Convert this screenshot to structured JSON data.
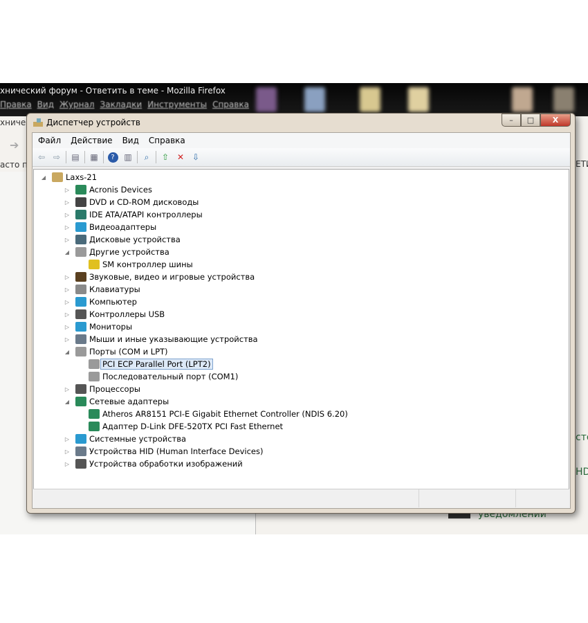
{
  "background": {
    "firefox_title": "хнический форум - Ответить в теме - Mozilla Firefox",
    "firefox_menu": [
      "Правка",
      "Вид",
      "Журнал",
      "Закладки",
      "Инструменты",
      "Справка"
    ],
    "side_texts": [
      "хнический",
      "асто по"
    ],
    "right_texts": [
      "ЕТИ",
      "сто",
      "HD"
    ],
    "notification_text": "уведомлений"
  },
  "window": {
    "title": "Диспетчер устройств",
    "controls": {
      "minimize": "–",
      "maximize": "□",
      "close": "X"
    },
    "menu": [
      "Файл",
      "Действие",
      "Вид",
      "Справка"
    ],
    "toolbar": [
      "back",
      "forward",
      "show-hide-tree",
      "properties",
      "help",
      "action-pane",
      "scan-hardware",
      "update-driver",
      "disable-device",
      "uninstall-device"
    ]
  },
  "tree": {
    "root": "Laxs-21",
    "items": [
      {
        "label": "Acronis Devices",
        "level": 1,
        "expanded": false,
        "icon": "monitor-network",
        "color": "#2a8a5a"
      },
      {
        "label": "DVD и CD-ROM дисководы",
        "level": 1,
        "expanded": false,
        "icon": "dvd-drive",
        "color": "#444444"
      },
      {
        "label": "IDE ATA/ATAPI контроллеры",
        "level": 1,
        "expanded": false,
        "icon": "ide-controller",
        "color": "#2a7a6a"
      },
      {
        "label": "Видеоадаптеры",
        "level": 1,
        "expanded": false,
        "icon": "video-adapter",
        "color": "#2a9ad0"
      },
      {
        "label": "Дисковые устройства",
        "level": 1,
        "expanded": false,
        "icon": "disk-drive",
        "color": "#4a6a7a"
      },
      {
        "label": "Другие устройства",
        "level": 1,
        "expanded": true,
        "icon": "unknown-device",
        "color": "#9a9a9a"
      },
      {
        "label": "SM контроллер шины",
        "level": 2,
        "icon": "warning-device",
        "color": "#e0c020"
      },
      {
        "label": "Звуковые, видео и игровые устройства",
        "level": 1,
        "expanded": false,
        "icon": "speaker",
        "color": "#5a4020"
      },
      {
        "label": "Клавиатуры",
        "level": 1,
        "expanded": false,
        "icon": "keyboard",
        "color": "#8a8a8a"
      },
      {
        "label": "Компьютер",
        "level": 1,
        "expanded": false,
        "icon": "computer",
        "color": "#2a9ad0"
      },
      {
        "label": "Контроллеры USB",
        "level": 1,
        "expanded": false,
        "icon": "usb",
        "color": "#555555"
      },
      {
        "label": "Мониторы",
        "level": 1,
        "expanded": false,
        "icon": "monitor",
        "color": "#2a9ad0"
      },
      {
        "label": "Мыши и иные указывающие устройства",
        "level": 1,
        "expanded": false,
        "icon": "mouse",
        "color": "#6a7a8a"
      },
      {
        "label": "Порты (COM и LPT)",
        "level": 1,
        "expanded": true,
        "icon": "port",
        "color": "#9a9a9a"
      },
      {
        "label": "PCI ECP Parallel Port (LPT2)",
        "level": 2,
        "icon": "port",
        "color": "#9a9a9a",
        "selected": true
      },
      {
        "label": "Последовательный порт (COM1)",
        "level": 2,
        "icon": "port",
        "color": "#9a9a9a"
      },
      {
        "label": "Процессоры",
        "level": 1,
        "expanded": false,
        "icon": "processor",
        "color": "#555555"
      },
      {
        "label": "Сетевые адаптеры",
        "level": 1,
        "expanded": true,
        "icon": "network-adapter",
        "color": "#2a8a5a"
      },
      {
        "label": "Atheros AR8151 PCI-E Gigabit Ethernet Controller (NDIS 6.20)",
        "level": 2,
        "icon": "network-adapter",
        "color": "#2a8a5a"
      },
      {
        "label": "Адаптер D-Link DFE-520TX PCI Fast Ethernet",
        "level": 2,
        "icon": "network-adapter",
        "color": "#2a8a5a"
      },
      {
        "label": "Системные устройства",
        "level": 1,
        "expanded": false,
        "icon": "system-device",
        "color": "#2a9ad0"
      },
      {
        "label": "Устройства HID (Human Interface Devices)",
        "level": 1,
        "expanded": false,
        "icon": "hid",
        "color": "#6a7a8a"
      },
      {
        "label": "Устройства обработки изображений",
        "level": 1,
        "expanded": false,
        "icon": "camera",
        "color": "#555555"
      }
    ]
  }
}
